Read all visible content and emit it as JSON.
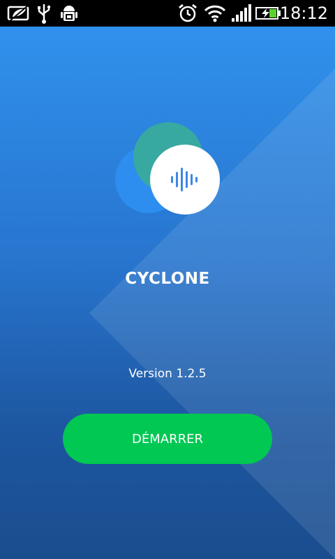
{
  "status_bar": {
    "time": "18:12",
    "icons": [
      "notification-leaf-icon",
      "usb-icon",
      "android-debug-icon",
      "alarm-icon",
      "wifi-icon",
      "signal-icon",
      "battery-charging-icon"
    ]
  },
  "app": {
    "name": "CYCLONE",
    "version": "Version 1.2.5",
    "start_label": "DÉMARRER"
  },
  "colors": {
    "accent": "#00c853",
    "background_top": "#3091ec",
    "background_bottom": "#1a4d8e",
    "logo_teal": "#38a9a0",
    "logo_wave": "#3d86e8"
  }
}
